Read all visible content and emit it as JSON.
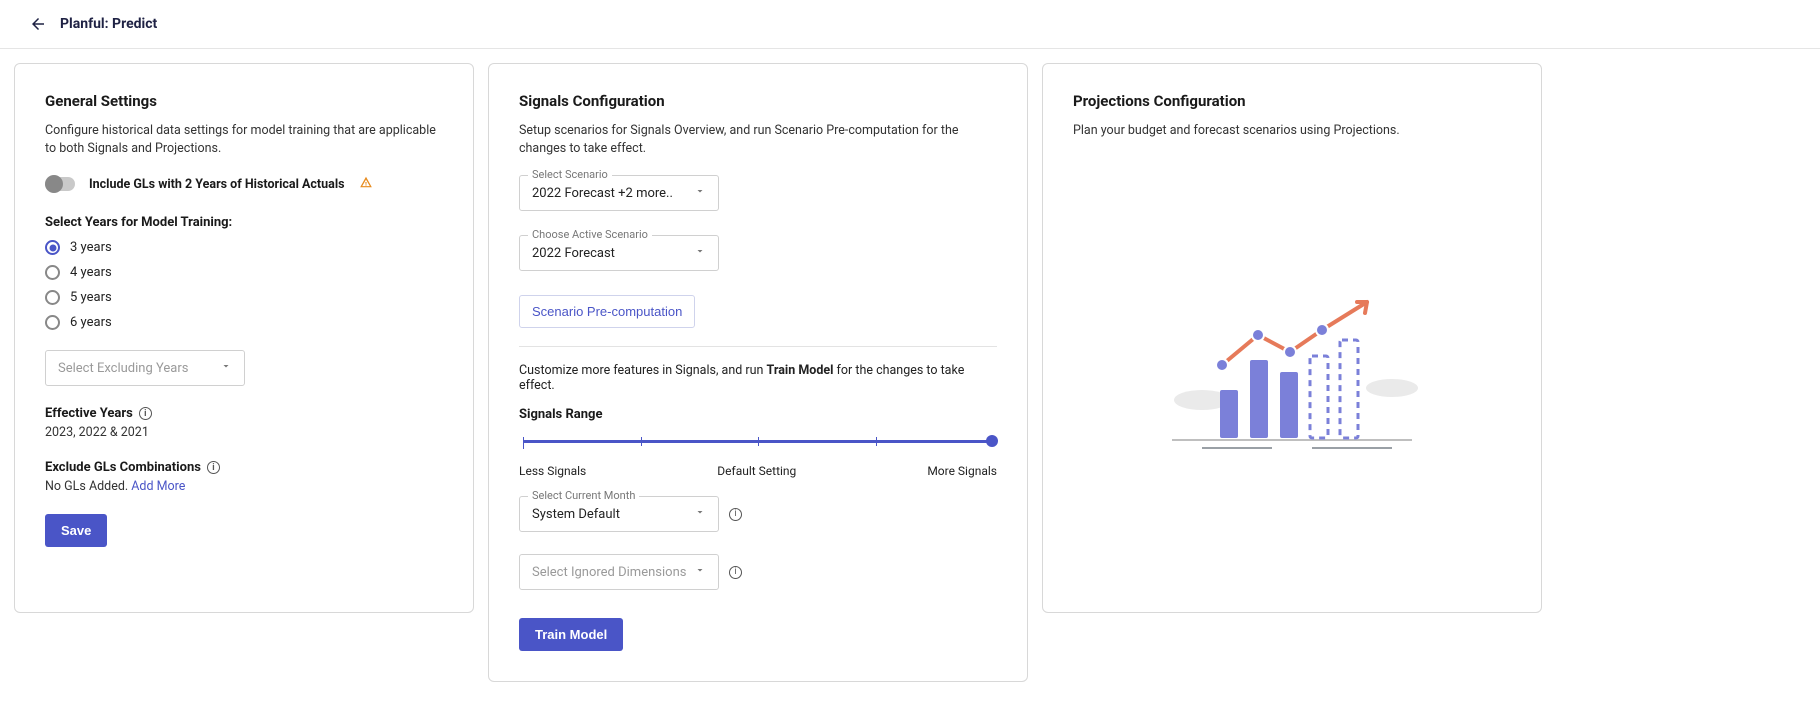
{
  "header": {
    "title": "Planful: Predict"
  },
  "general": {
    "heading": "General Settings",
    "desc": "Configure historical data settings for model training that are applicable to both Signals and Projections.",
    "toggle_label": "Include GLs with 2 Years of Historical Actuals",
    "years_label": "Select Years for Model Training:",
    "years_options": [
      "3 years",
      "4 years",
      "5 years",
      "6 years"
    ],
    "excluding_placeholder": "Select Excluding Years",
    "effective_label": "Effective Years",
    "effective_value": "2023, 2022 & 2021",
    "exclude_label": "Exclude GLs Combinations",
    "exclude_value_prefix": "No GLs Added. ",
    "exclude_add_more": "Add More",
    "save_label": "Save"
  },
  "signals": {
    "heading": "Signals Configuration",
    "desc": "Setup scenarios for Signals Overview, and run Scenario Pre-computation for the changes to take effect.",
    "select_scenario_label": "Select Scenario",
    "select_scenario_value": "2022 Forecast  +2 more..",
    "active_scenario_label": "Choose Active Scenario",
    "active_scenario_value": "2022 Forecast",
    "precompute_label": "Scenario Pre-computation",
    "customize_prefix": "Customize more features in Signals, and run ",
    "customize_bold": "Train Model",
    "customize_suffix": " for the changes to take effect.",
    "range_label": "Signals Range",
    "range_min": "Less Signals",
    "range_mid": "Default Setting",
    "range_max": "More Signals",
    "current_month_label": "Select Current Month",
    "current_month_value": "System Default",
    "ignored_dims_placeholder": "Select Ignored Dimensions",
    "train_label": "Train Model"
  },
  "projections": {
    "heading": "Projections Configuration",
    "desc": "Plan your budget and forecast scenarios using Projections."
  }
}
